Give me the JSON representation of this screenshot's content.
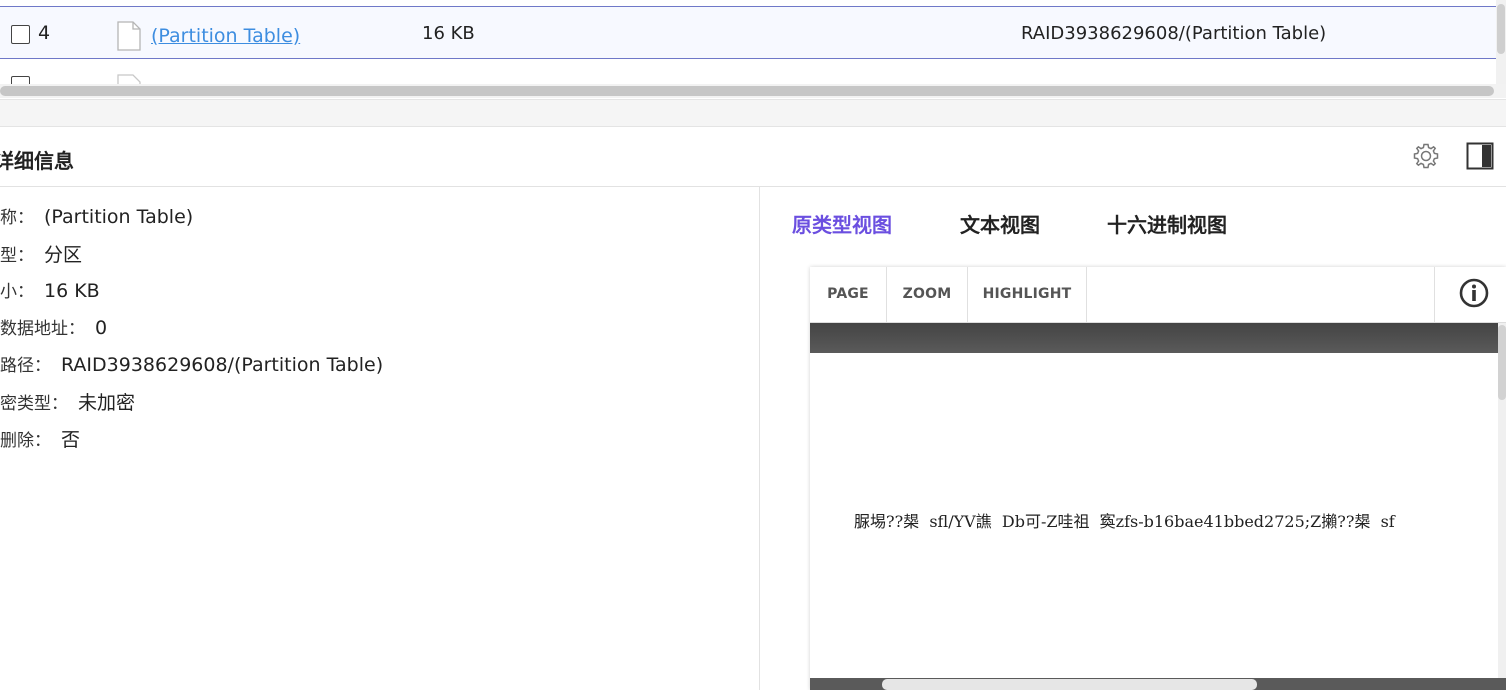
{
  "table": {
    "selected_row": {
      "index": "4",
      "name": "(Partition Table)",
      "size": "16 KB",
      "path": "RAID3938629608/(Partition Table)"
    }
  },
  "details": {
    "title": "详细信息",
    "properties": [
      {
        "label": "称：",
        "value": "(Partition Table)"
      },
      {
        "label": "型：",
        "value": "分区"
      },
      {
        "label": "小：",
        "value": "16 KB"
      },
      {
        "label": "数据地址：",
        "value": "0"
      },
      {
        "label": "路径：",
        "value": "RAID3938629608/(Partition Table)"
      },
      {
        "label": "密类型：",
        "value": "未加密"
      },
      {
        "label": "删除：",
        "value": "否"
      }
    ]
  },
  "viewer": {
    "tabs": [
      "原类型视图",
      "文本视图",
      "十六进制视图"
    ],
    "active_tab": 0,
    "toolbar": {
      "page": "PAGE",
      "zoom": "ZOOM",
      "highlight": "HIGHLIGHT"
    },
    "content_text": "脲埸??槼  sfl/YV譙  Db可-Z哇祖  寏zfs-b16bae41bbed2725;Z攋??槼  sf"
  },
  "icons": {
    "settings": "gear-icon",
    "panel_toggle": "panel-toggle-icon",
    "info": "info-icon",
    "file": "file-icon"
  },
  "colors": {
    "accent": "#6b4fe0",
    "link": "#3d8de0",
    "selected_border": "#6f78c8"
  }
}
